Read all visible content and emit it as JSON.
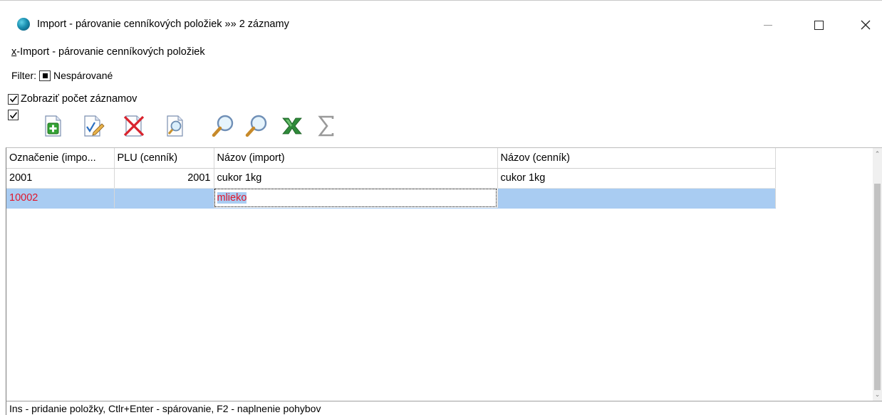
{
  "window": {
    "title": "Import - párovanie cenníkových položiek »» 2 záznamy",
    "icon": "globe-icon"
  },
  "menu": {
    "accel": "x",
    "label_rest": "-Import - párovanie cenníkových položiek"
  },
  "filter": {
    "label": "Filter:",
    "value": "Nespárované"
  },
  "show_count": {
    "label": "Zobraziť počet záznamov",
    "checked": true
  },
  "toolbar": {
    "buttons": [
      "add-icon",
      "edit-icon",
      "delete-icon",
      "preview-icon",
      "search-icon",
      "search-next-icon",
      "excel-icon",
      "sum-icon"
    ]
  },
  "grid": {
    "columns": [
      "Označenie (impo...",
      "PLU (cenník)",
      "Názov (import)",
      "Názov (cenník)"
    ],
    "rows": [
      [
        "2001",
        "2001",
        "cukor 1kg",
        "cukor 1kg"
      ],
      [
        "10002",
        "",
        "mlieko",
        ""
      ]
    ],
    "selected_row": 1
  },
  "status": {
    "text": "Ins - pridanie položky, Ctlr+Enter - spárovanie, F2 - naplnenie pohybov"
  },
  "colors": {
    "selection": "#a9ccf2",
    "unmatched_text": "#e0172b"
  }
}
